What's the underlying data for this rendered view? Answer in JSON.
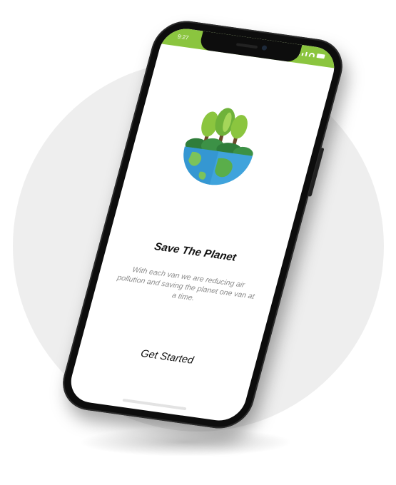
{
  "status_bar": {
    "time": "9:27",
    "color": "#8bc53f"
  },
  "screen": {
    "illustration_icon": "earth-trees-icon",
    "title": "Save The Planet",
    "description": "With each van we are reducing air pollution and saving the planet one van at a time.",
    "cta_label": "Get Started"
  }
}
